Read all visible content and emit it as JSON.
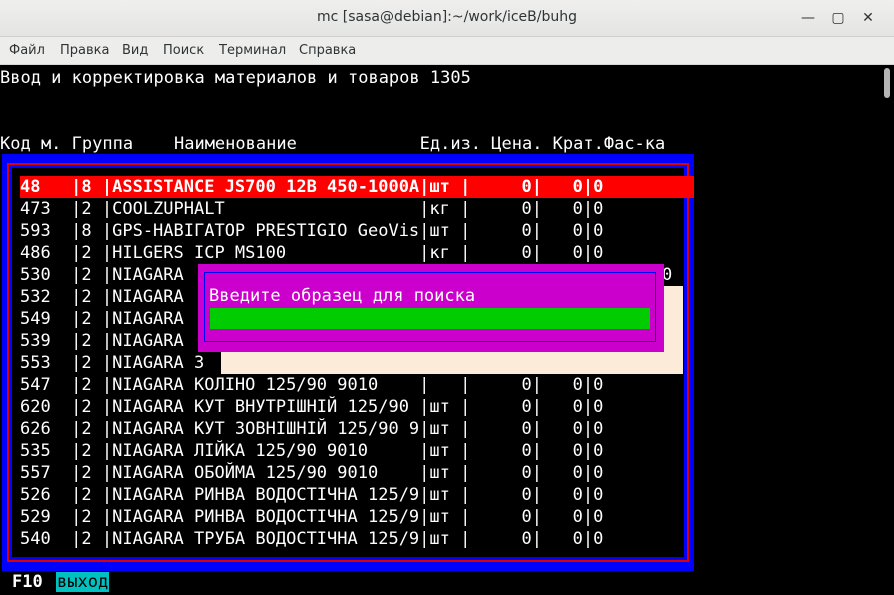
{
  "window": {
    "title": "mc [sasa@debian]:~/work/iceB/buhg"
  },
  "menu": [
    "Файл",
    "Правка",
    "Вид",
    "Поиск",
    "Терминал",
    "Справка"
  ],
  "screen": {
    "heading": "Ввод и корректировка материалов и товаров 1305",
    "columns": "Код м. Группа    Наименование            Ед.из. Цена. Крат.Фас-ка",
    "rows": [
      "48   |8 |ASSISTANCE JS700 12B 450-1000A|шт |     0|   0|0",
      "473  |2 |COOLZUPHALT                   |кг |     0|   0|0",
      "593  |8 |GPS-НАВIГАТОР PRESTIGIO GeoVis|шт |     0|   0|0",
      "486  |2 |HILGERS ICP MS100             |кг |     0|   0|0",
      "530  |2 |NIAGARA",
      "532  |2 |NIAGARA",
      "549  |2 |NIAGARA",
      "539  |2 |NIAGARA",
      "553  |2 |NIAGARA З",
      "547  |2 |NIAGARA КОЛIНО 125/90 9010    |   |     0|   0|0",
      "620  |2 |NIAGARA КУТ ВНУТРIШНIЙ 125/90 |шт |     0|   0|0",
      "626  |2 |NIAGARA КУТ ЗОВНIШНIЙ 125/90 9|шт |     0|   0|0",
      "535  |2 |NIAGARA ЛIЙКА 125/90 9010     |шт |     0|   0|0",
      "557  |2 |NIAGARA ОБОЙМА 125/90 9010    |шт |     0|   0|0",
      "526  |2 |NIAGARA РИНВА ВОДОСТIЧНА 125/9|шт |     0|   0|0",
      "529  |2 |NIAGARA РИНВА ВОДОСТIЧНА 125/9|шт |     0|   0|0",
      "540  |2 |NIAGARA ТРУБА ВОДОСТIЧНА 125/9|шт |     0|   0|0"
    ],
    "row530_tail": "0"
  },
  "dialog": {
    "prompt": "Введите образец для поиска",
    "value": ""
  },
  "footer": {
    "key": "F10",
    "label": "выход"
  },
  "colors": {
    "frame": "#0000ff",
    "selected_row": "#ff0000",
    "dialog": "#cc00cc",
    "input": "#00cc00"
  }
}
